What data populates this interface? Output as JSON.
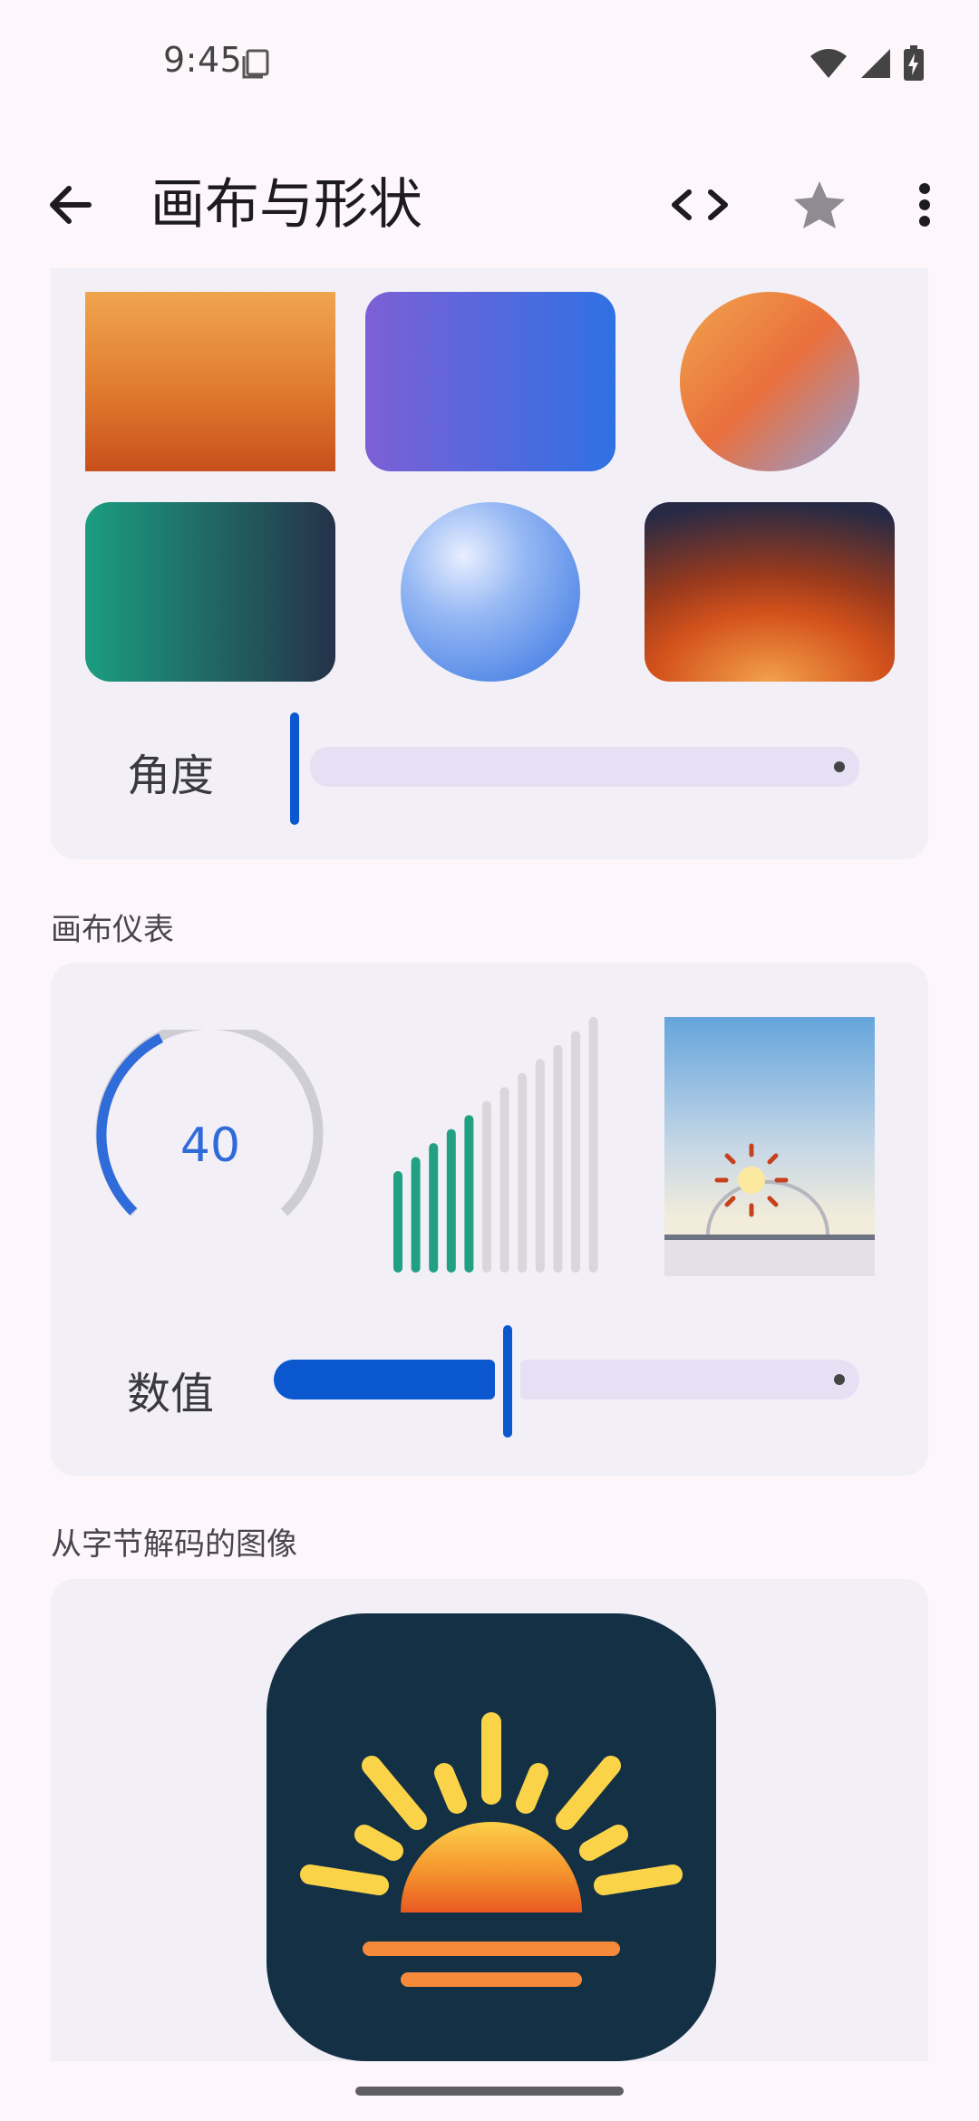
{
  "status_bar": {
    "time": "9:45"
  },
  "app_bar": {
    "title": "画布与形状"
  },
  "gradients_card": {
    "angle_label": "角度",
    "angle_value": 0
  },
  "gauge_section": {
    "title": "画布仪表",
    "gauge_value": "40",
    "gauge_fraction": 0.4,
    "bars_total": 12,
    "bars_active": 5,
    "value_label": "数值",
    "value_fraction": 0.4
  },
  "image_section": {
    "title": "从字节解码的图像"
  },
  "colors": {
    "primary": "#0b57d0",
    "gauge_arc": "#2f6bd9",
    "bar_active": "#22a082",
    "bar_inactive": "#d9d6dc",
    "icon_bg": "#133045"
  }
}
